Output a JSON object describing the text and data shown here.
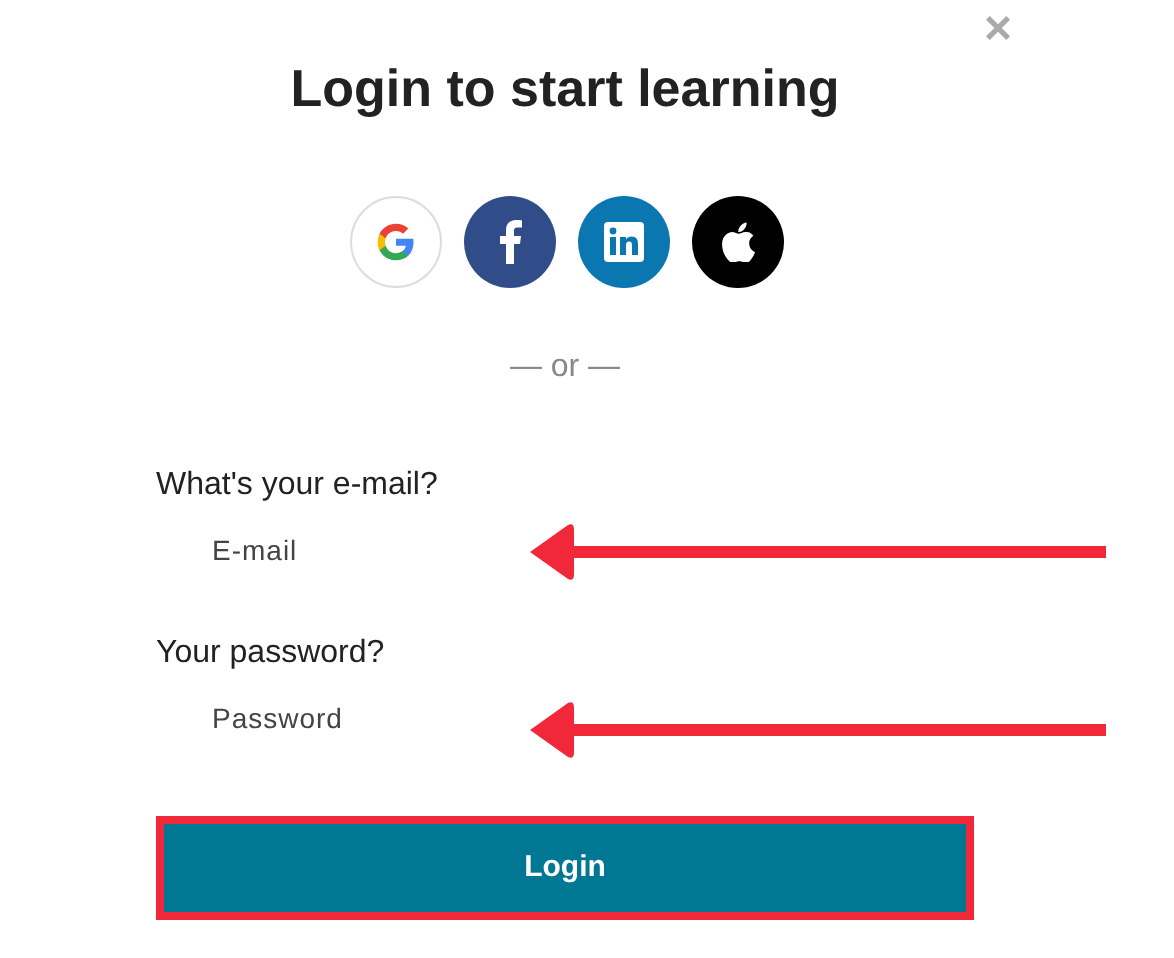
{
  "title": "Login to start learning",
  "close": "×",
  "social_buttons": [
    {
      "kind": "google"
    },
    {
      "kind": "facebook"
    },
    {
      "kind": "linkedin"
    },
    {
      "kind": "apple"
    }
  ],
  "divider": "— or —",
  "fields": [
    {
      "label": "What's your e-mail?",
      "placeholder": "E-mail"
    },
    {
      "label": "Your password?",
      "placeholder": "Password"
    }
  ],
  "submit": "Login"
}
